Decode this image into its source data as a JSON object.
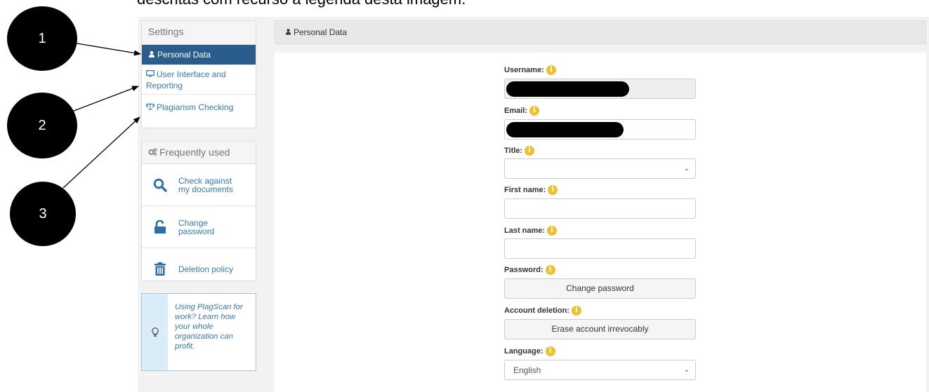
{
  "caption": "descritas com recurso à legenda desta imagem.",
  "annotations": [
    "1",
    "2",
    "3"
  ],
  "settings": {
    "header": "Settings",
    "items": [
      {
        "label": "Personal Data",
        "icon": "user-icon"
      },
      {
        "label": "User Interface and Reporting",
        "icon": "monitor-icon"
      },
      {
        "label": "Plagiarism Checking",
        "icon": "scale-icon"
      }
    ]
  },
  "frequently_used": {
    "header": "Frequently used",
    "items": [
      {
        "label": "Check against my documents",
        "icon": "search-icon"
      },
      {
        "label": "Change password",
        "icon": "unlock-icon"
      },
      {
        "label": "Deletion policy",
        "icon": "trash-icon"
      }
    ]
  },
  "tip": {
    "text": "Using PlagScan for work? Learn how your whole organization can profit.",
    "icon": "lightbulb-icon"
  },
  "main": {
    "header_title": "Personal Data",
    "fields": {
      "username_label": "Username:",
      "email_label": "Email:",
      "title_label": "Title:",
      "title_value": "",
      "first_name_label": "First name:",
      "first_name_value": "",
      "last_name_label": "Last name:",
      "last_name_value": "",
      "password_label": "Password:",
      "change_password_button": "Change password",
      "account_deletion_label": "Account deletion:",
      "erase_account_button": "Erase account irrevocably",
      "language_label": "Language:",
      "language_value": "English"
    }
  },
  "colors": {
    "active_item_bg": "#2a5d8c",
    "link": "#337ab7",
    "info_icon": "#f0c030",
    "tip_bg": "#d9ecf7"
  }
}
